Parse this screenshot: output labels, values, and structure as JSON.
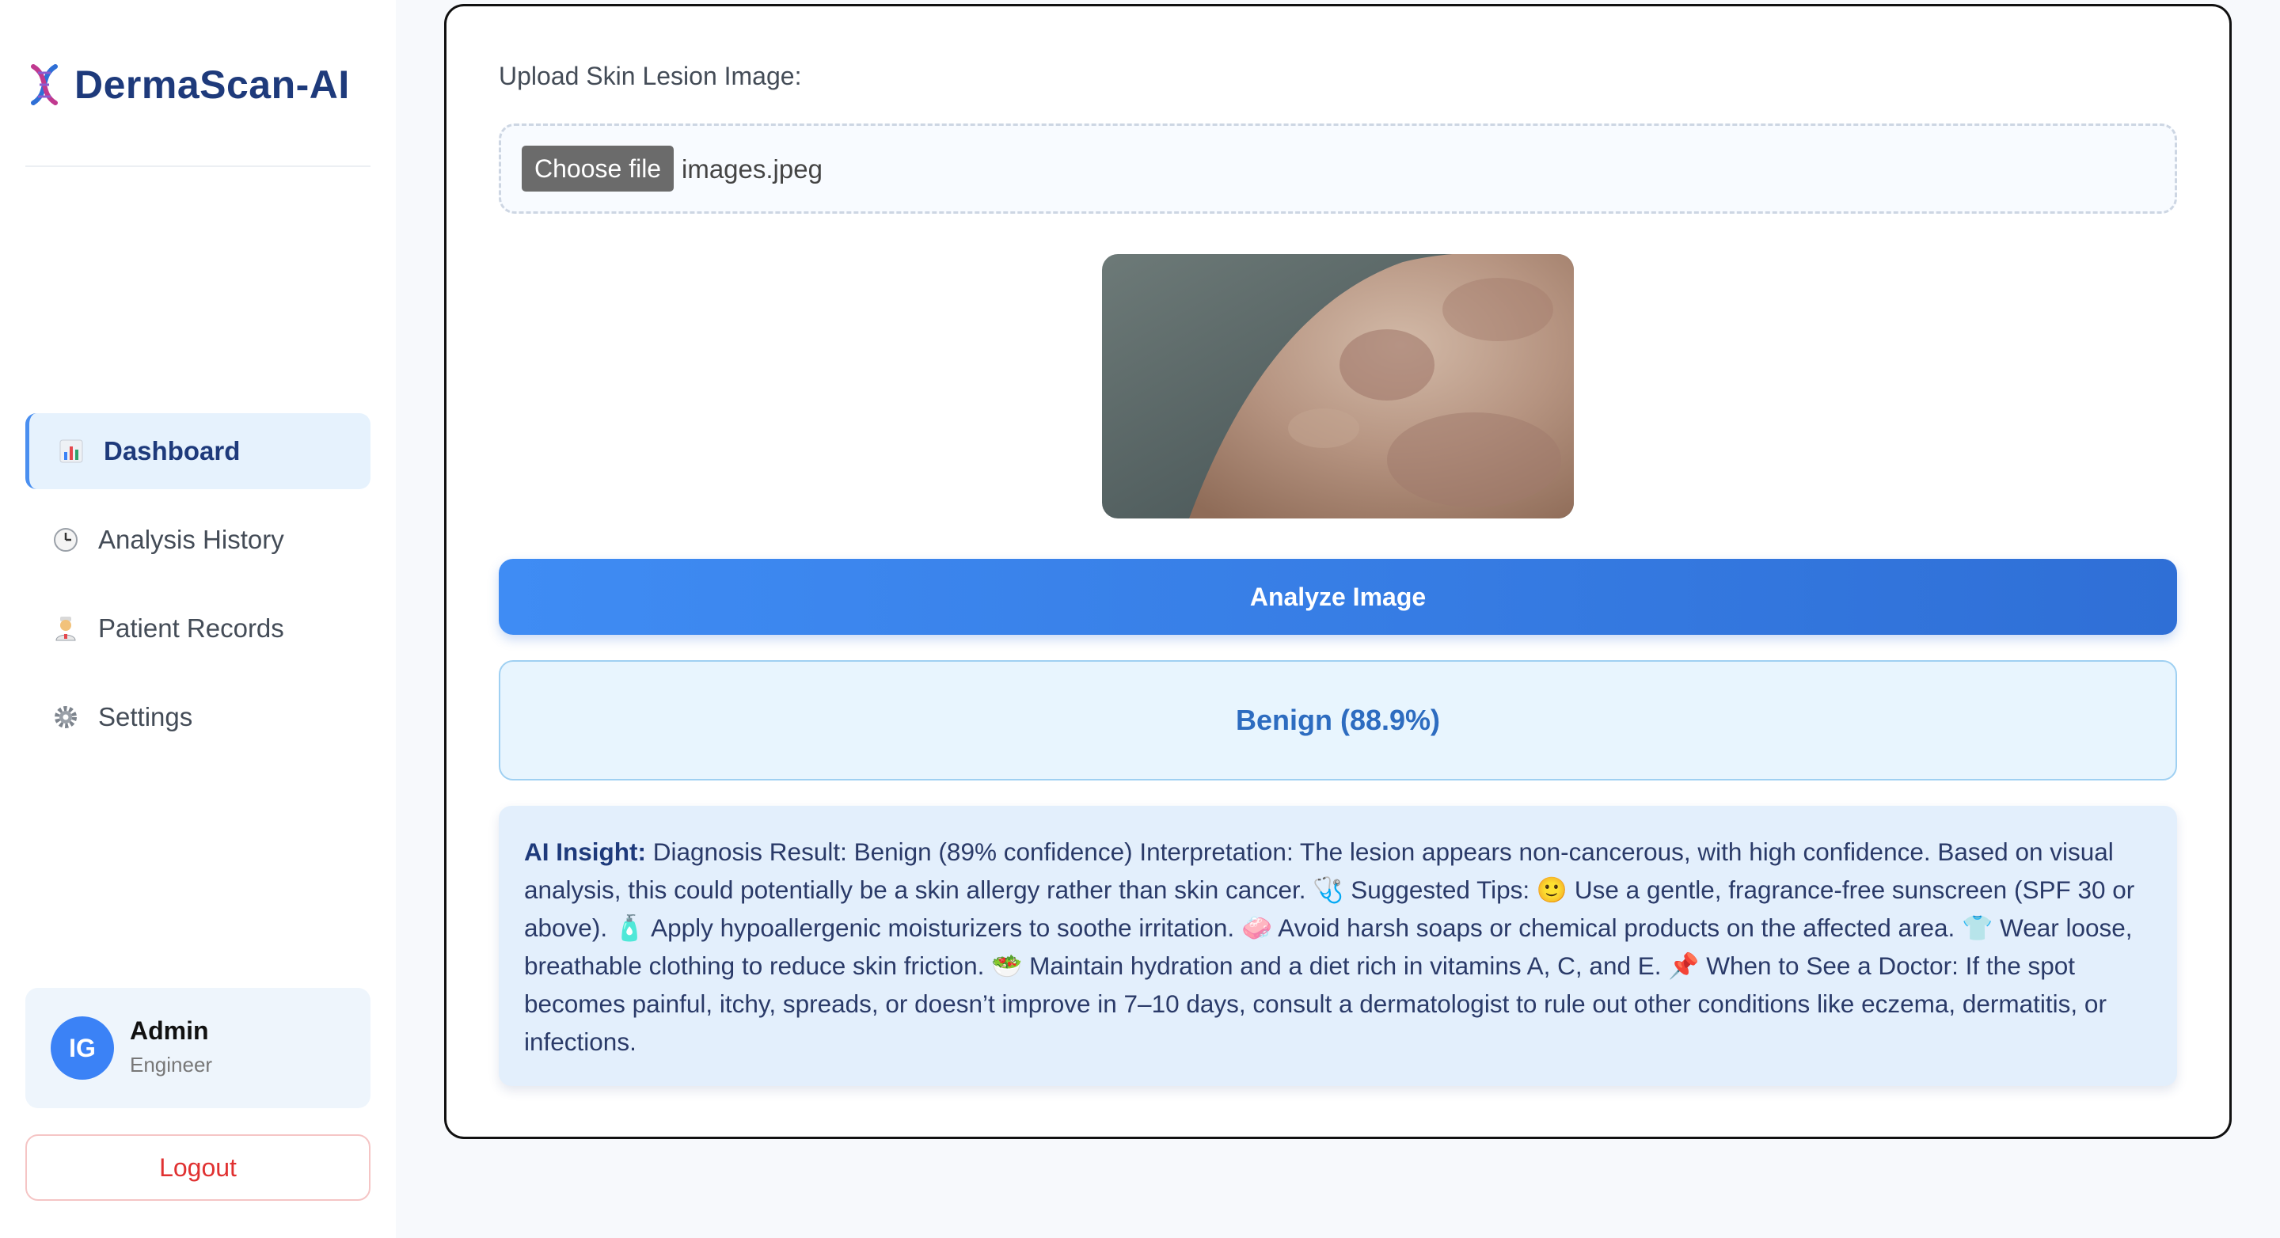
{
  "app": {
    "title": "DermaScan-AI",
    "logo_icon": "dna-icon"
  },
  "sidebar": {
    "items": [
      {
        "label": "Dashboard",
        "icon": "bar-chart-icon",
        "active": true
      },
      {
        "label": "Analysis History",
        "icon": "clock-icon",
        "active": false
      },
      {
        "label": "Patient Records",
        "icon": "health-worker-icon",
        "active": false
      },
      {
        "label": "Settings",
        "icon": "gear-icon",
        "active": false
      }
    ],
    "user": {
      "initials": "IG",
      "name": "Admin",
      "role": "Engineer"
    },
    "logout_label": "Logout"
  },
  "main": {
    "upload_label": "Upload Skin Lesion Image:",
    "choose_file_label": "Choose file",
    "file_name": "images.jpeg",
    "analyze_label": "Analyze Image",
    "result": "Benign (88.9%)",
    "insight_label": "AI Insight:",
    "insight_segments": [
      " Diagnosis Result: Benign (89% confidence) Interpretation: The lesion appears non-cancerous, with high confidence. Based on visual analysis, this could potentially be a skin allergy rather than skin cancer. ",
      " Suggested Tips: ",
      " Use a gentle, fragrance-free sunscreen (SPF 30 or above). ",
      " Apply hypoallergenic moisturizers to soothe irritation. ",
      " Avoid harsh soaps or chemical products on the affected area. ",
      " Wear loose, breathable clothing to reduce skin friction. ",
      " Maintain hydration and a diet rich in vitamins A, C, and E. ",
      " When to See a Doctor: If the spot becomes painful, itchy, spreads, or doesn’t improve in 7–10 days, consult a dermatologist to rule out other conditions like eczema, dermatitis, or infections."
    ],
    "insight_icons": [
      "stethoscope-icon",
      "smiley-icon",
      "lotion-icon",
      "soap-icon",
      "shirt-icon",
      "salad-icon",
      "pushpin-icon"
    ]
  },
  "colors": {
    "brand": "#1e3a7b",
    "accent": "#3f8cf4",
    "result_text": "#2d6cc0",
    "logout": "#e03131"
  }
}
